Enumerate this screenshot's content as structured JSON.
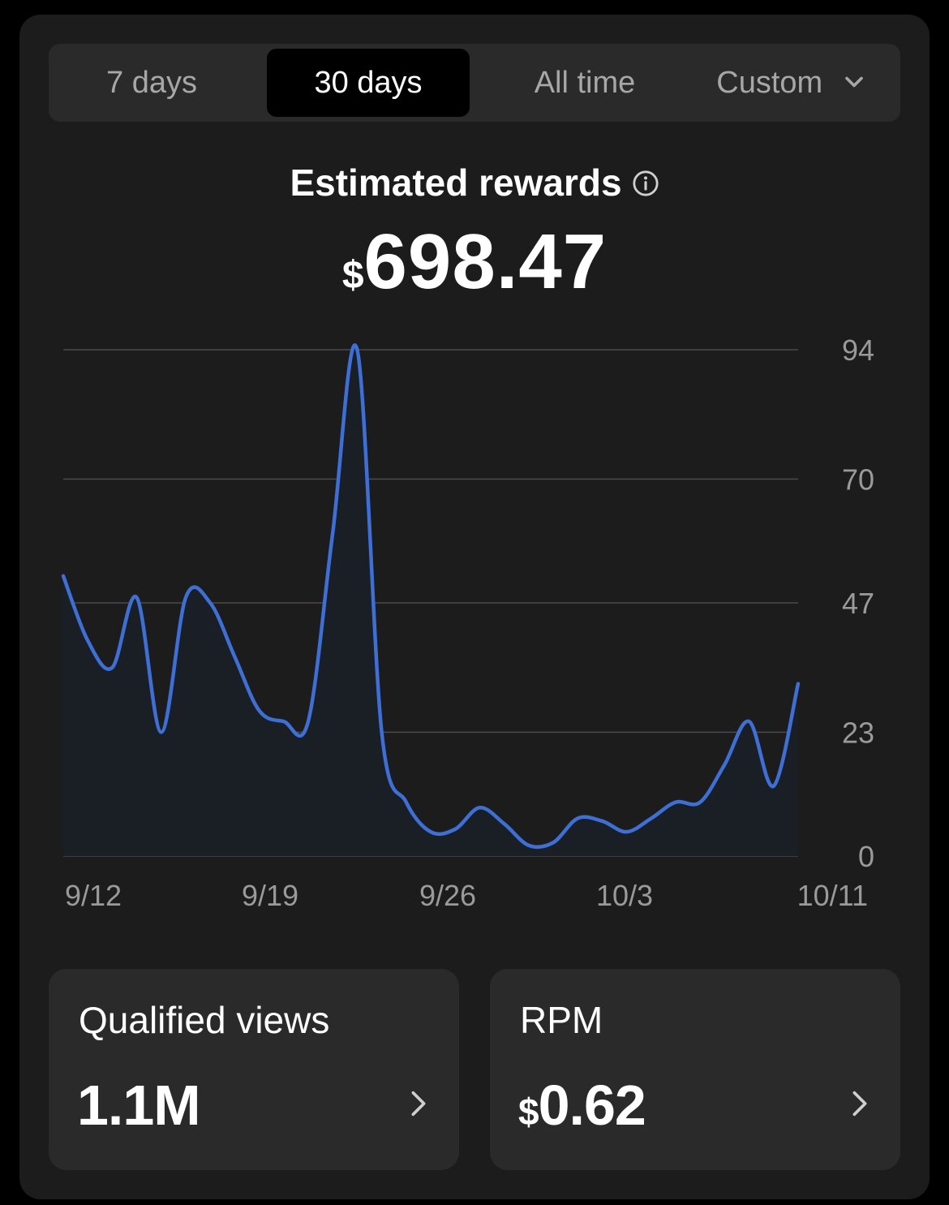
{
  "tabs": [
    {
      "label": "7 days",
      "active": false
    },
    {
      "label": "30 days",
      "active": true
    },
    {
      "label": "All time",
      "active": false
    },
    {
      "label": "Custom",
      "active": false,
      "icon": "chevron-down-icon"
    }
  ],
  "summary": {
    "title": "Estimated rewards",
    "info_icon": "info-icon",
    "currency": "$",
    "amount": "698.47"
  },
  "colors": {
    "line": "#3d6fd6",
    "area": "#1a1f26",
    "grid": "#4a4a4a",
    "axis_text": "#9a9a9a"
  },
  "chart_data": {
    "type": "area",
    "title": "Estimated rewards",
    "x_start": "9/12",
    "x_end": "10/11",
    "x_tick_labels": [
      "9/12",
      "9/19",
      "9/26",
      "10/3",
      "10/11"
    ],
    "y_tick_labels": [
      "0",
      "23",
      "47",
      "70",
      "94"
    ],
    "y_ticks": [
      0,
      23,
      47,
      70,
      94
    ],
    "ylim": [
      0,
      94
    ],
    "grid": true,
    "y_axis_position": "right",
    "series": [
      {
        "values": [
          52,
          40,
          35,
          48,
          23,
          48,
          47,
          37,
          27,
          25,
          25,
          60,
          94,
          23,
          10,
          4.5,
          5,
          9,
          6,
          2,
          2.5,
          7,
          6.5,
          4.5,
          7,
          10,
          10,
          17,
          25,
          13,
          32
        ]
      }
    ]
  },
  "stats": [
    {
      "label": "Qualified views",
      "currency": "",
      "value": "1.1M",
      "icon": "chevron-right-icon"
    },
    {
      "label": "RPM",
      "currency": "$",
      "value": "0.62",
      "icon": "chevron-right-icon"
    }
  ]
}
